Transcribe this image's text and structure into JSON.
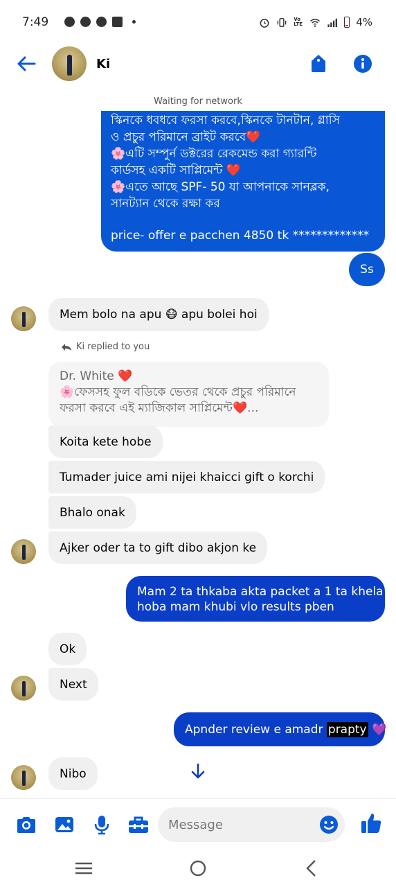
{
  "status_bar": {
    "time": "7:49",
    "battery": "4%",
    "network_label": "Vo LTE"
  },
  "header": {
    "contact_name": "Ki"
  },
  "network_status": "Waiting for network",
  "messages": {
    "big_outgoing": {
      "lines": [
        "স্কিনকে ধবধবে ফরসা করবে,স্কিনকে টানটান, গ্লাসি",
        "ও প্রচুর পরিমানে ব্রাইট  করবে❤️",
        "🌸এটি সম্পুর্ন  ডক্টরের রেকমেন্ড করা গ্যারন্টি",
        "কার্ডসহ একটি সাপ্লিমেন্ট ❤️",
        "🌸এতে আছে SPF- 50 যা আপনাকে সানব্লক,",
        "সানট্যান থেকে রক্ষা কর"
      ],
      "price_line": "price- offer e pacchen 4850 tk *************"
    },
    "ss": "Ss",
    "mem_bolo": "Mem bolo na apu  😷 apu bolei hoi",
    "reply_meta": "Ki replied to you",
    "quoted": {
      "line1": "Dr. White ❤️",
      "line2": "🌸ফেসসহ ফুল বডিকে ভেতর থেকে প্রচুর পরিমানে",
      "line3": "ফরসা করবে এই ম্যাজিকাল সাপ্লিমেন্ট❤️..."
    },
    "koita": "Koita kete hobe",
    "tumader": "Tumader juice ami nijei khaicci gift o korchi",
    "bhalo": "Bhalo onak",
    "ajker": "Ajker oder ta to gift dibo akjon ke",
    "mam2": {
      "line1": "Mam 2 ta thkaba akta packet a 1 ta khela",
      "line2": "hoba mam khubi vlo results pben"
    },
    "ok": "Ok",
    "next": "Next",
    "apnder": {
      "text": "Apnder review e amadr ",
      "highlight": "prapty",
      "emoji": " 💜"
    },
    "nibo": "Nibo"
  },
  "composer": {
    "placeholder": "Message"
  },
  "colors": {
    "messenger_blue": "#0a57d6",
    "dark_blue": "#0b3ec7",
    "incoming_bg": "#f0f0f0",
    "icon_blue": "#0a5bd8"
  }
}
